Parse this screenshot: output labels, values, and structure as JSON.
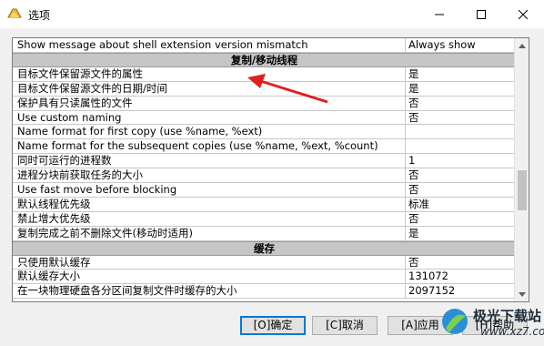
{
  "window": {
    "title": "选项"
  },
  "grid": {
    "rows": [
      {
        "type": "row",
        "key": "Show message about shell extension version mismatch",
        "value": "Always show"
      },
      {
        "type": "section",
        "key": "复制/移动线程"
      },
      {
        "type": "row",
        "key": "目标文件保留源文件的属性",
        "value": "是"
      },
      {
        "type": "row",
        "key": "目标文件保留源文件的日期/时间",
        "value": "是"
      },
      {
        "type": "row",
        "key": "保护具有只读属性的文件",
        "value": "否"
      },
      {
        "type": "row",
        "key": "Use custom naming",
        "value": "否"
      },
      {
        "type": "row",
        "key": "Name format for first copy (use %name, %ext)",
        "value": ""
      },
      {
        "type": "row",
        "key": "Name format for the subsequent copies (use %name, %ext, %count)",
        "value": ""
      },
      {
        "type": "row",
        "key": "同时可运行的进程数",
        "value": "1"
      },
      {
        "type": "row",
        "key": "进程分块前获取任务的大小",
        "value": "否"
      },
      {
        "type": "row",
        "key": "Use fast move before blocking",
        "value": "否"
      },
      {
        "type": "row",
        "key": "默认线程优先级",
        "value": "标准"
      },
      {
        "type": "row",
        "key": "禁止增大优先级",
        "value": "否"
      },
      {
        "type": "row",
        "key": "复制完成之前不删除文件(移动时适用)",
        "value": "是"
      },
      {
        "type": "section",
        "key": "缓存"
      },
      {
        "type": "row",
        "key": "只使用默认缓存",
        "value": "否"
      },
      {
        "type": "row",
        "key": "默认缓存大小",
        "value": "131072"
      },
      {
        "type": "row",
        "key": "在一块物理硬盘各分区间复制文件时缓存的大小",
        "value": "2097152"
      }
    ]
  },
  "buttons": {
    "ok": "[O]确定",
    "cancel": "[C]取消",
    "apply": "[A]应用",
    "help": "[H]帮助"
  },
  "watermark": {
    "text": "极光下载站",
    "url": "www.xz7.com"
  },
  "colors": {
    "arrow": "#e02020",
    "accent": "#0078d7",
    "section": "#c6c6c6"
  }
}
